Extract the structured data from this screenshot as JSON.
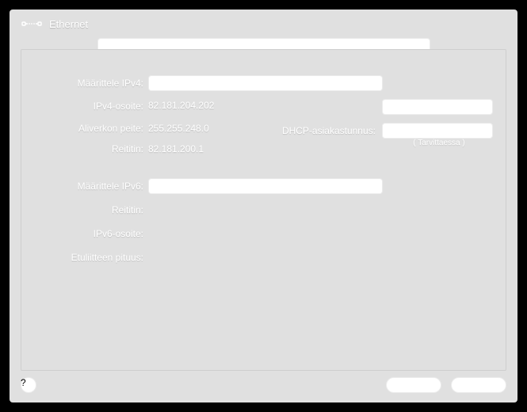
{
  "header": {
    "title": "Ethernet"
  },
  "labels": {
    "configure_ipv4": "Määrittele IPv4:",
    "ipv4_address": "IPv4-osoite:",
    "subnet_mask": "Aliverkon peite:",
    "router_v4": "Reititin:",
    "dhcp_client_id": "DHCP-asiakastunnus:",
    "dhcp_hint": "( Tarvittaessa )",
    "configure_ipv6": "Määrittele IPv6:",
    "router_v6": "Reititin:",
    "ipv6_address": "IPv6-osoite:",
    "prefix_length": "Etuliitteen pituus:"
  },
  "values": {
    "ipv4_address": "82.181.204.202",
    "subnet_mask": "255.255.248.0",
    "router_v4": "82.181.200.1",
    "dhcp_client_id": "",
    "dhcp_lease_btn": "",
    "configure_ipv4_selected": "",
    "configure_ipv6_selected": "",
    "router_v6": "",
    "ipv6_address": "",
    "prefix_length": ""
  },
  "footer": {
    "help": "?",
    "cancel": "",
    "ok": ""
  }
}
